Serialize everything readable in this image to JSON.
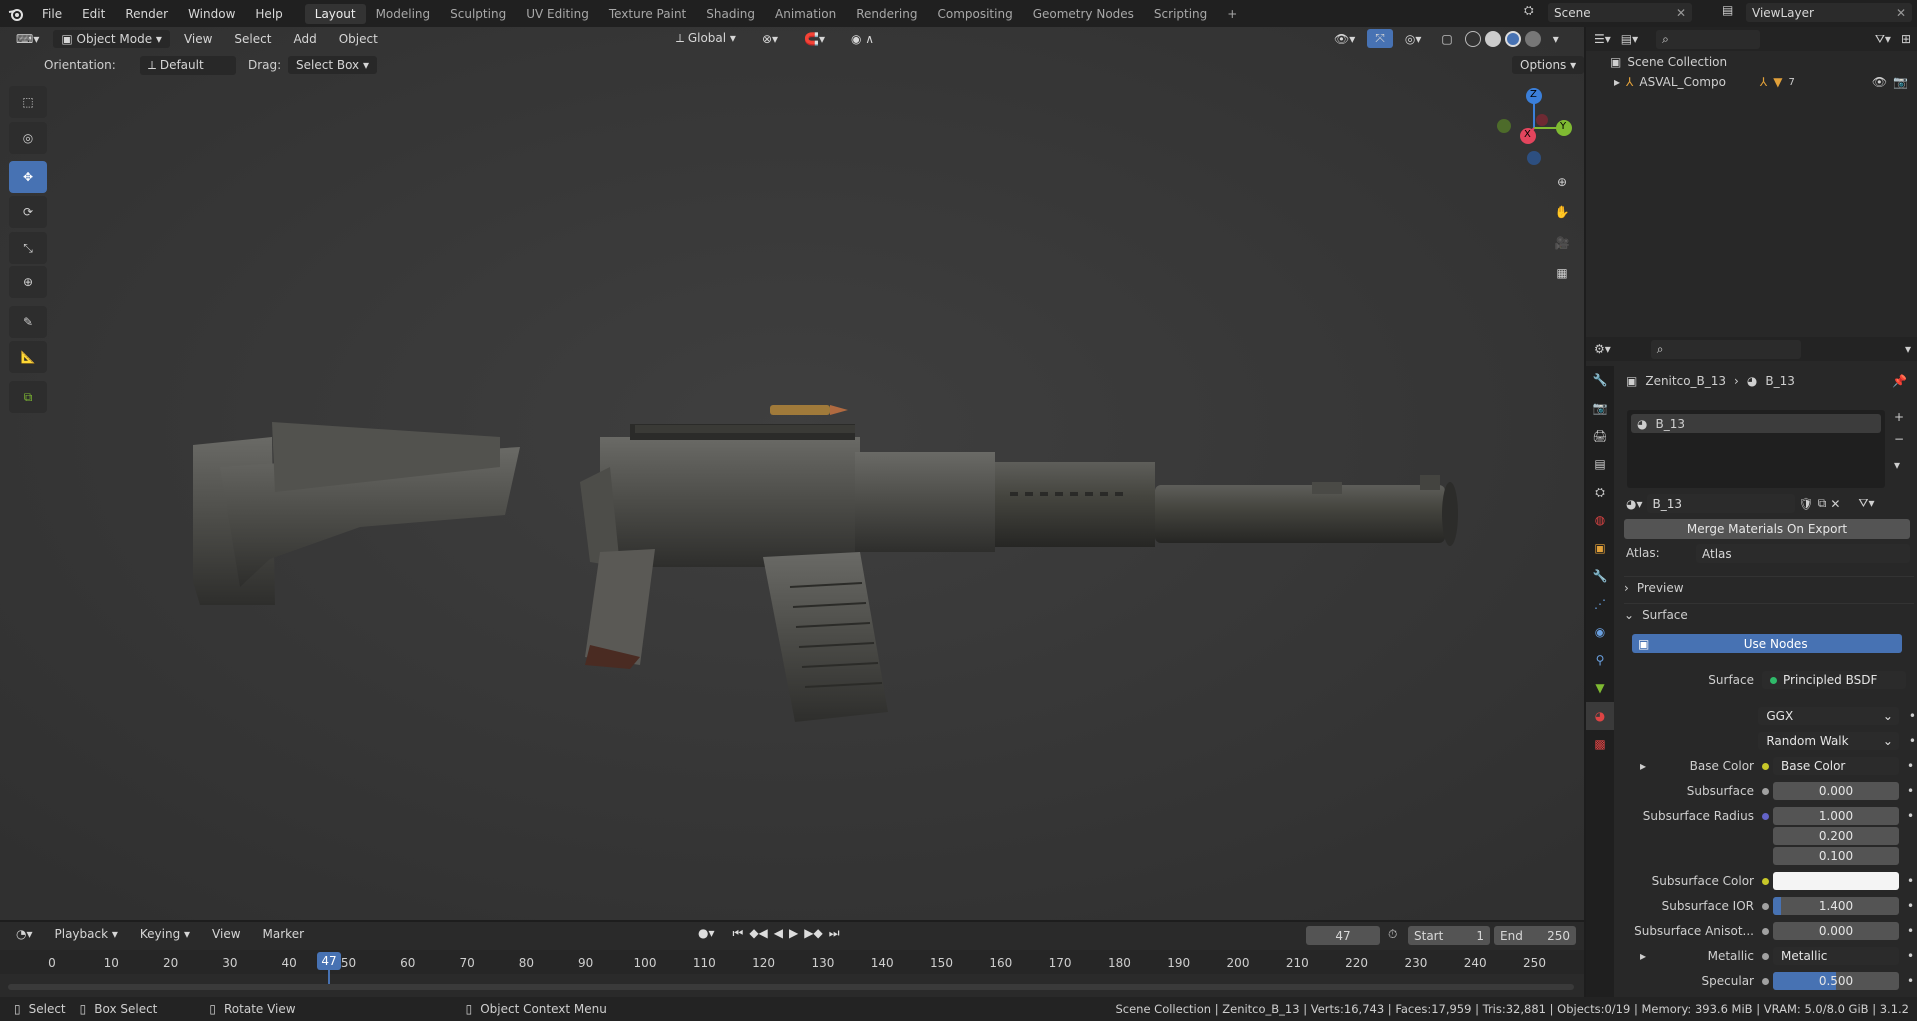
{
  "topbar": {
    "menus": [
      "File",
      "Edit",
      "Render",
      "Window",
      "Help"
    ],
    "workspaces": [
      "Layout",
      "Modeling",
      "Sculpting",
      "UV Editing",
      "Texture Paint",
      "Shading",
      "Animation",
      "Rendering",
      "Compositing",
      "Geometry Nodes",
      "Scripting"
    ],
    "active_workspace": "Layout",
    "plus": "+",
    "scene": "Scene",
    "viewlayer": "ViewLayer"
  },
  "viewport": {
    "mode": "Object Mode",
    "menus": [
      "View",
      "Select",
      "Add",
      "Object"
    ],
    "transform": "Global",
    "orientation_label": "Orientation:",
    "orientation_value": "Default",
    "drag_label": "Drag:",
    "drag_value": "Select Box",
    "options": "Options",
    "gizmo": {
      "z": "Z",
      "x": "X",
      "y": "Y"
    }
  },
  "tools": [
    "select-box",
    "cursor",
    "move",
    "rotate",
    "scale",
    "transform",
    "annotate",
    "measure",
    "add-cube"
  ],
  "outliner": {
    "root": "Scene Collection",
    "item": "ASVAL_Compo",
    "badge": "7"
  },
  "properties": {
    "breadcrumb_object": "Zenitco_B_13",
    "breadcrumb_material": "B_13",
    "slot": "B_13",
    "material_name": "B_13",
    "merge_button": "Merge Materials On Export",
    "atlas_label": "Atlas:",
    "atlas_value": "Atlas",
    "preview": "Preview",
    "surface_panel": "Surface",
    "use_nodes": "Use Nodes",
    "surface_label": "Surface",
    "surface_value": "Principled BSDF",
    "distribution": "GGX",
    "subsurface_method": "Random Walk",
    "rows": [
      {
        "label": "Base Color",
        "value": "Base Color",
        "kind": "link",
        "dot": "#c7c729"
      },
      {
        "label": "Subsurface",
        "value": "0.000",
        "kind": "num",
        "dot": "#a1a1a1"
      },
      {
        "label": "Subsurface Radius",
        "value": "1.000",
        "kind": "num",
        "dot": "#6363c7"
      },
      {
        "label": "",
        "value": "0.200",
        "kind": "num",
        "dot": ""
      },
      {
        "label": "",
        "value": "0.100",
        "kind": "num",
        "dot": ""
      },
      {
        "label": "Subsurface Color",
        "value": "",
        "kind": "color",
        "dot": "#c7c729"
      },
      {
        "label": "Subsurface IOR",
        "value": "1.400",
        "kind": "num",
        "dot": "#a1a1a1",
        "fill": 0.06
      },
      {
        "label": "Subsurface Anisot...",
        "value": "0.000",
        "kind": "num",
        "dot": "#a1a1a1"
      },
      {
        "label": "Metallic",
        "value": "Metallic",
        "kind": "link",
        "dot": "#a1a1a1"
      },
      {
        "label": "Specular",
        "value": "0.500",
        "kind": "num",
        "dot": "#a1a1a1",
        "fill": 0.5
      }
    ]
  },
  "timeline": {
    "menus": [
      "Playback",
      "Keying",
      "View",
      "Marker"
    ],
    "current_frame": "47",
    "start_label": "Start",
    "start": "1",
    "end_label": "End",
    "end": "250",
    "ticks": [
      "0",
      "10",
      "20",
      "30",
      "40",
      "50",
      "60",
      "70",
      "80",
      "90",
      "100",
      "110",
      "120",
      "130",
      "140",
      "150",
      "160",
      "170",
      "180",
      "190",
      "200",
      "210",
      "220",
      "230",
      "240",
      "250"
    ]
  },
  "status": {
    "select": "Select",
    "box_select": "Box Select",
    "rotate_view": "Rotate View",
    "context_menu": "Object Context Menu",
    "info": "Scene Collection | Zenitco_B_13 | Verts:16,743 | Faces:17,959 | Tris:32,881 | Objects:0/19 | Memory: 393.6 MiB | VRAM: 5.0/8.0 GiB | 3.1.2"
  },
  "colors": {
    "accent": "#4772b3",
    "gizmo_x": "#e3455d",
    "gizmo_y": "#7fba32",
    "gizmo_z": "#3b7fd9"
  }
}
